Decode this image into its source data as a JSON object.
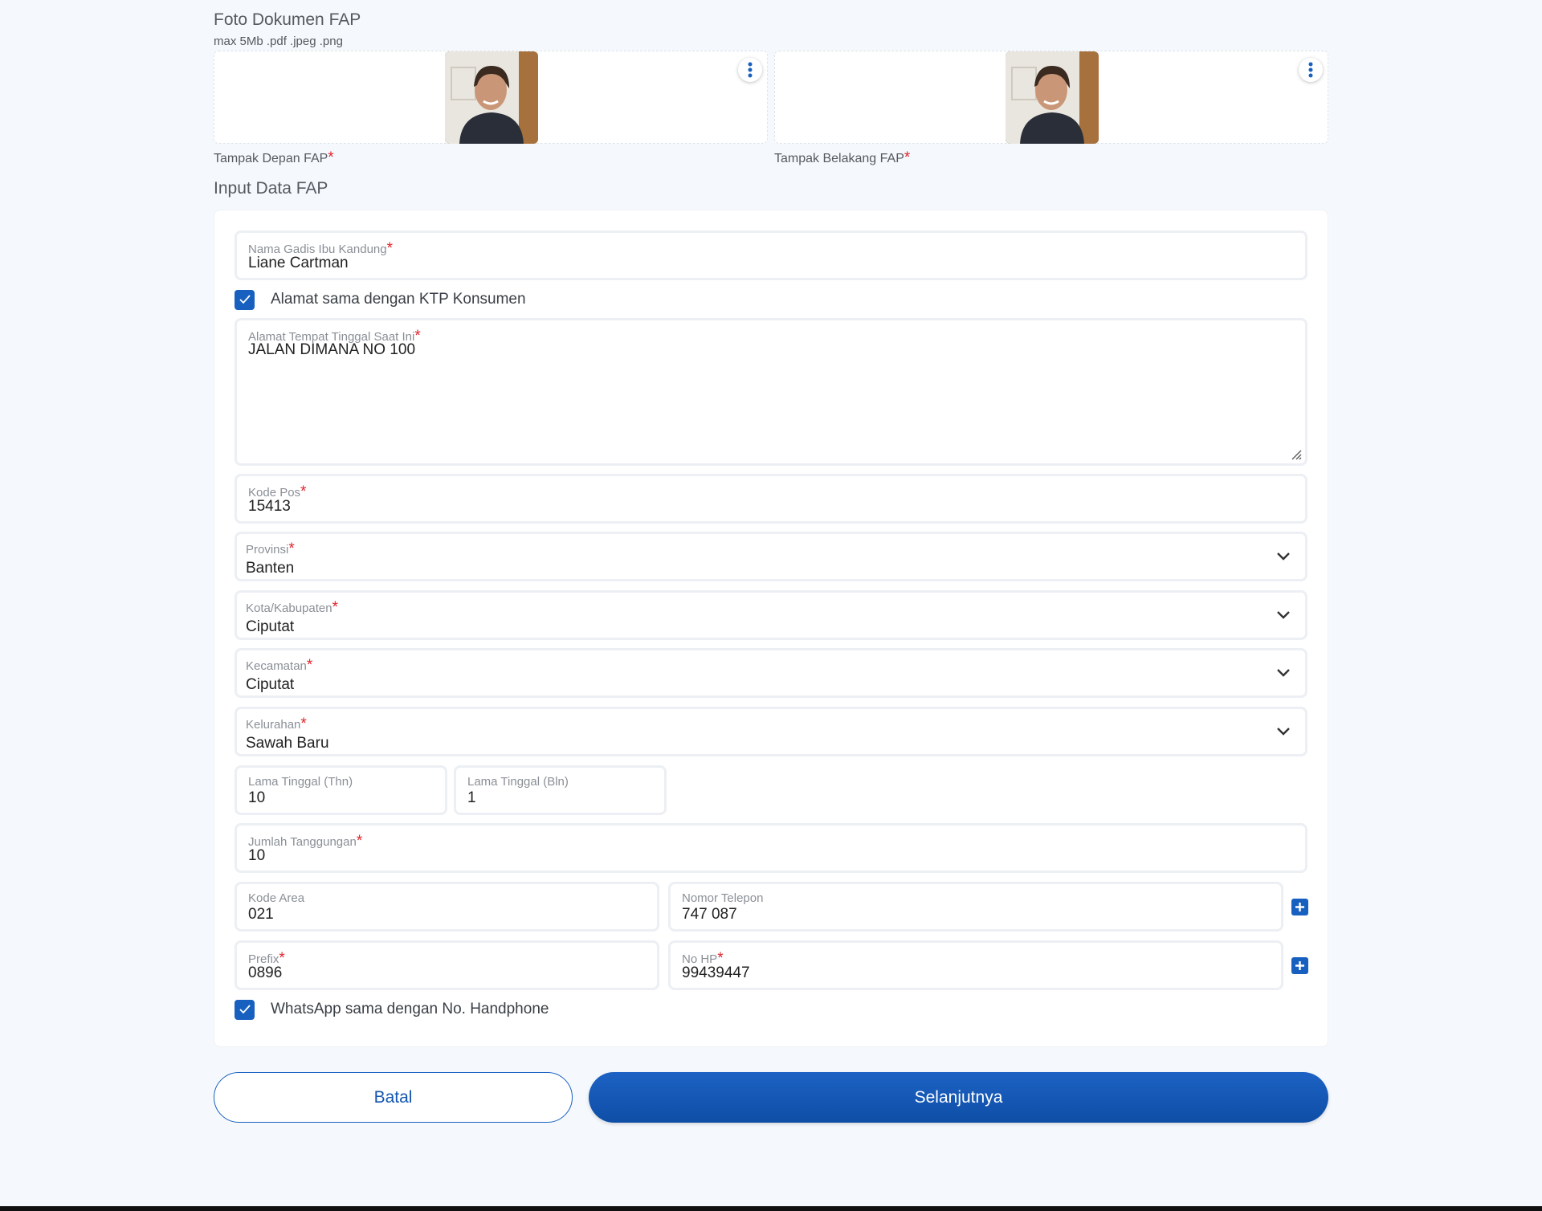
{
  "documents": {
    "title": "Foto Dokumen FAP",
    "hint": "max 5Mb .pdf .jpeg .png",
    "front": {
      "caption": "Tampak Depan FAP",
      "required": "*",
      "menu_icon": "kebab-vertical-icon"
    },
    "back": {
      "caption": "Tampak Belakang FAP",
      "required": "*",
      "menu_icon": "kebab-vertical-icon"
    }
  },
  "form": {
    "title": "Input Data FAP",
    "mother_name": {
      "label": "Nama Gadis Ibu Kandung",
      "required": "*",
      "value": "Liane Cartman"
    },
    "same_address_checkbox": {
      "label": "Alamat sama dengan KTP Konsumen",
      "checked": true
    },
    "address": {
      "label": "Alamat Tempat Tinggal Saat Ini",
      "required": "*",
      "value": "JALAN DIMANA NO 100"
    },
    "postal_code": {
      "label": "Kode Pos",
      "required": "*",
      "value": "15413"
    },
    "province": {
      "label": "Provinsi",
      "required": "*",
      "value": "Banten"
    },
    "city": {
      "label": "Kota/Kabupaten",
      "required": "*",
      "value": "Ciputat"
    },
    "district": {
      "label": "Kecamatan",
      "required": "*",
      "value": "Ciputat"
    },
    "subdistrict": {
      "label": "Kelurahan",
      "required": "*",
      "value": "Sawah Baru"
    },
    "stay_years": {
      "label": "Lama Tinggal (Thn)",
      "value": "10"
    },
    "stay_months": {
      "label": "Lama Tinggal (Bln)",
      "value": "1"
    },
    "dependents": {
      "label": "Jumlah Tanggungan",
      "required": "*",
      "value": "10"
    },
    "area_code": {
      "label": "Kode Area",
      "value": "021"
    },
    "phone": {
      "label": "Nomor Telepon",
      "value": "747 087"
    },
    "prefix": {
      "label": "Prefix",
      "required": "*",
      "value": "0896"
    },
    "mobile": {
      "label": "No HP",
      "required": "*",
      "value": "99439447"
    },
    "whatsapp_checkbox": {
      "label": "WhatsApp sama dengan No. Handphone",
      "checked": true
    }
  },
  "actions": {
    "cancel": "Batal",
    "next": "Selanjutnya"
  },
  "colors": {
    "primary": "#1760bf",
    "required": "#e0242c",
    "background": "#f5f9fd"
  }
}
